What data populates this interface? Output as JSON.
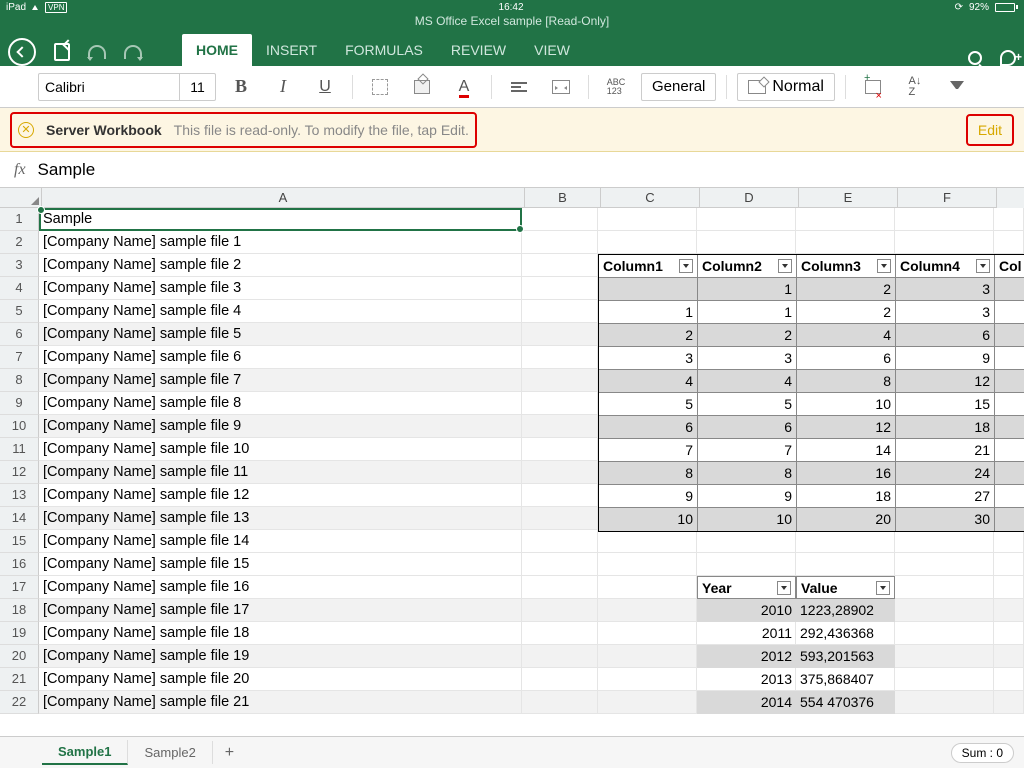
{
  "status": {
    "device": "iPad",
    "vpn": "VPN",
    "time": "16:42",
    "battery": "92%"
  },
  "doc_title": "MS Office Excel sample [Read-Only]",
  "tabs": [
    "HOME",
    "INSERT",
    "FORMULAS",
    "REVIEW",
    "VIEW"
  ],
  "ribbon": {
    "font": "Calibri",
    "size": "11",
    "format": "General",
    "style": "Normal"
  },
  "banner": {
    "title": "Server Workbook",
    "msg": "This file is read-only. To modify the file, tap Edit.",
    "edit": "Edit"
  },
  "fx": "Sample",
  "columns": [
    "A",
    "B",
    "C",
    "D",
    "E",
    "F"
  ],
  "colA": [
    "Sample",
    "[Company Name] sample file 1",
    "[Company Name] sample file 2",
    "[Company Name] sample file 3",
    "[Company Name] sample file 4",
    "[Company Name] sample file 5",
    "[Company Name] sample file 6",
    "[Company Name] sample file 7",
    "[Company Name] sample file 8",
    "[Company Name] sample file 9",
    "[Company Name] sample file 10",
    "[Company Name] sample file 11",
    "[Company Name] sample file 12",
    "[Company Name] sample file 13",
    "[Company Name] sample file 14",
    "[Company Name] sample file 15",
    "[Company Name] sample file 16",
    "[Company Name] sample file 17",
    "[Company Name] sample file 18",
    "[Company Name] sample file 19",
    "[Company Name] sample file 20",
    "[Company Name] sample file 21"
  ],
  "table": {
    "headers": [
      "Column1",
      "Column2",
      "Column3",
      "Column4",
      "Col"
    ],
    "rows": [
      [
        "",
        "1",
        "2",
        "3",
        ""
      ],
      [
        "1",
        "1",
        "2",
        "3",
        ""
      ],
      [
        "2",
        "2",
        "4",
        "6",
        ""
      ],
      [
        "3",
        "3",
        "6",
        "9",
        ""
      ],
      [
        "4",
        "4",
        "8",
        "12",
        ""
      ],
      [
        "5",
        "5",
        "10",
        "15",
        ""
      ],
      [
        "6",
        "6",
        "12",
        "18",
        ""
      ],
      [
        "7",
        "7",
        "14",
        "21",
        ""
      ],
      [
        "8",
        "8",
        "16",
        "24",
        ""
      ],
      [
        "9",
        "9",
        "18",
        "27",
        ""
      ],
      [
        "10",
        "10",
        "20",
        "30",
        ""
      ]
    ]
  },
  "table2": {
    "headers": [
      "Year",
      "Value"
    ],
    "rows": [
      [
        "2010",
        "1223,28902"
      ],
      [
        "2011",
        "292,436368"
      ],
      [
        "2012",
        "593,201563"
      ],
      [
        "2013",
        "375,868407"
      ],
      [
        "2014",
        "554 470376"
      ]
    ]
  },
  "sheets": [
    "Sample1",
    "Sample2"
  ],
  "sum": "Sum : 0"
}
